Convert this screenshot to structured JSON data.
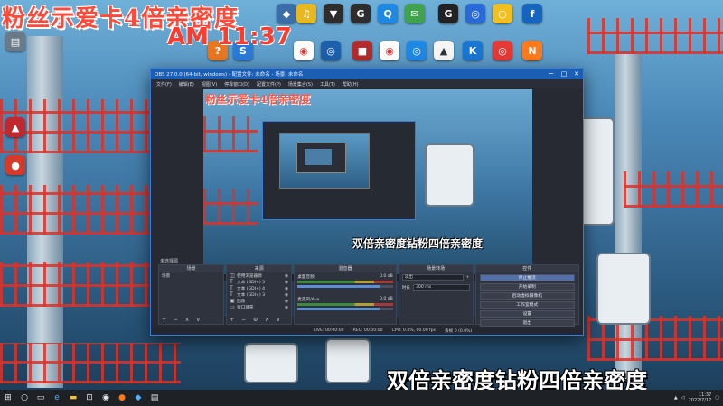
{
  "overlay": {
    "top_text": "粉丝示爱卡4倍亲密度",
    "clock_text": "AM 11:37",
    "bottom_text": "双倍亲密度钻粉四倍亲密度"
  },
  "obs": {
    "title": "OBS 27.0.0 (64-bit, windows) - 配置文件: 未命名 - 场景: 未命名",
    "menu": [
      "文件(F)",
      "编辑(E)",
      "视图(V)",
      "停靠窗口(D)",
      "配置文件(P)",
      "场景集合(S)",
      "工具(T)",
      "帮助(H)"
    ],
    "preview_top_text": "粉丝示爱卡4倍亲密度",
    "preview_bottom_text": "双倍亲密度钻粉四倍亲密度",
    "toolbar_label": "未选择源",
    "docks": {
      "scenes": {
        "title": "场景",
        "items": [
          "场景"
        ]
      },
      "sources": {
        "title": "来源",
        "items": [
          "使用浏览器源",
          "文本 (GDI+) 5",
          "文本 (GDI+) 4",
          "文本 (GDI+) 3",
          "图像",
          "窗口捕获"
        ]
      },
      "mixer": {
        "title": "混音器",
        "channels": [
          {
            "name": "桌面音频",
            "db": "0.0 dB",
            "level": 0.55
          },
          {
            "name": "麦克风/Aux",
            "db": "0.0 dB",
            "level": 0.55
          }
        ]
      },
      "transitions": {
        "title": "场景转场",
        "type": "淡出",
        "duration_label": "时长",
        "duration": "300 ms"
      },
      "controls": {
        "title": "控件",
        "buttons": [
          "停止推流",
          "开始录制",
          "启动虚拟摄像机",
          "工作室模式",
          "设置",
          "退出"
        ]
      }
    },
    "status": {
      "live": "LIVE: 00:00:00",
      "rec": "REC: 00:00:00",
      "cpu": "CPU: 0.4%, 60.00 fps",
      "dropped": "丢帧 0 (0.0%)"
    }
  },
  "taskbar": {
    "time": "11:37",
    "date": "2022/7/17"
  },
  "colors": {
    "overlay_red": "#ff4a3a",
    "obs_accent": "#1a5fb4",
    "obs_bg": "#272a33"
  }
}
